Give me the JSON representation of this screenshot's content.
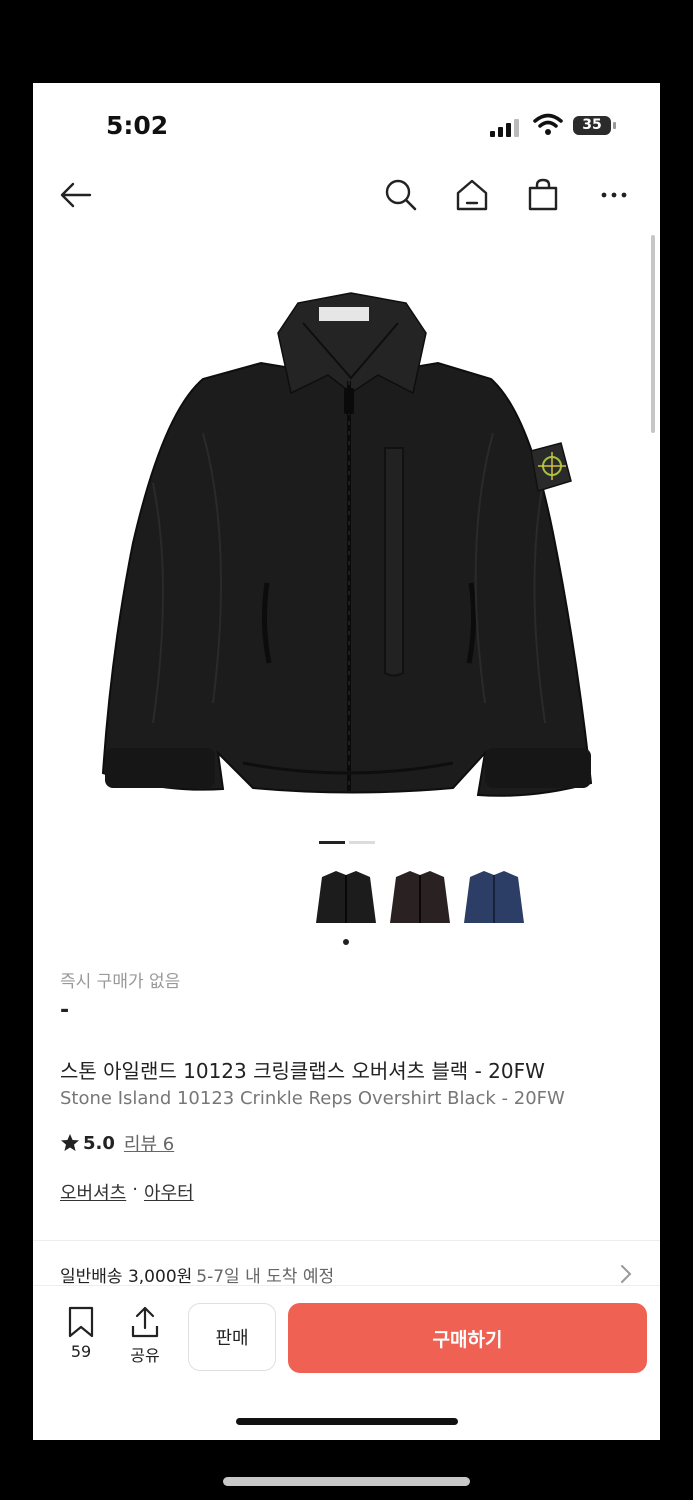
{
  "status_bar": {
    "time": "5:02",
    "battery": "35"
  },
  "nav": {
    "back_icon": "back-arrow-icon",
    "search_icon": "search-icon",
    "home_icon": "home-icon",
    "cart_icon": "shopping-bag-icon",
    "more_icon": "more-icon"
  },
  "product": {
    "image_pager": {
      "count": 2,
      "current": 1
    },
    "thumbnails": [
      {
        "color": "#1c1c1c",
        "selected": true
      },
      {
        "color": "#2a2222",
        "selected": false
      },
      {
        "color": "#2c3d66",
        "selected": false
      }
    ],
    "instant_purchase_label": "즉시 구매가 없음",
    "price": "-",
    "name_ko": "스톤 아일랜드 10123 크링클랩스 오버셔츠 블랙 - 20FW",
    "name_en": "Stone Island 10123 Crinkle Reps Overshirt Black - 20FW",
    "rating": "5.0",
    "review_label": "리뷰 6",
    "categories": [
      "오버셔츠",
      "아우터"
    ],
    "category_separator": "·",
    "shipping": {
      "label": "일반배송 3,000원",
      "date": "5-7일 내 도착 예정"
    }
  },
  "bottom_bar": {
    "bookmark_count": "59",
    "share_label": "공유",
    "sell_label": "판매",
    "buy_label": "구매하기"
  },
  "colors": {
    "accent": "#ef6253",
    "text": "#222222",
    "muted": "#999999"
  }
}
